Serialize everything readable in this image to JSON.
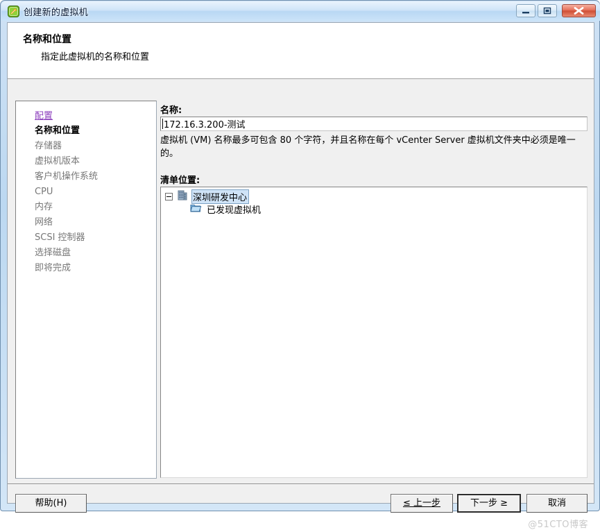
{
  "window": {
    "title": "创建新的虚拟机",
    "app_icon": "vm-new-icon",
    "controls": {
      "minimize": "minimize-icon",
      "maximize": "maximize-icon",
      "close": "close-icon"
    }
  },
  "header": {
    "title": "名称和位置",
    "subtitle": "指定此虚拟机的名称和位置"
  },
  "sidebar": {
    "items": [
      {
        "label": "配置",
        "state": "link"
      },
      {
        "label": "名称和位置",
        "state": "current"
      },
      {
        "label": "存储器",
        "state": "pending"
      },
      {
        "label": "虚拟机版本",
        "state": "pending"
      },
      {
        "label": "客户机操作系统",
        "state": "pending"
      },
      {
        "label": "CPU",
        "state": "pending"
      },
      {
        "label": "内存",
        "state": "pending"
      },
      {
        "label": "网络",
        "state": "pending"
      },
      {
        "label": "SCSI 控制器",
        "state": "pending"
      },
      {
        "label": "选择磁盘",
        "state": "pending"
      },
      {
        "label": "即将完成",
        "state": "pending"
      }
    ]
  },
  "main": {
    "name_label": "名称:",
    "name_value": "172.16.3.200-测试",
    "name_placeholder": "",
    "description": "虚拟机 (VM) 名称最多可包含 80 个字符，并且名称在每个 vCenter Server 虚拟机文件夹中必须是唯一的。",
    "location_label": "清单位置:",
    "tree": [
      {
        "label": "深圳研发中心",
        "icon": "datacenter-icon",
        "selected": true,
        "expanded": true
      },
      {
        "label": "已发现虚拟机",
        "icon": "folder-icon",
        "selected": false,
        "expanded": false
      }
    ]
  },
  "footer": {
    "help": "帮助(H)",
    "help_mnemonic": "H",
    "back": "≤ 上一步",
    "next": "下一步 ≥",
    "cancel": "取消"
  },
  "watermark": "@51CTO博客",
  "colors": {
    "accent_link": "#8c3fbd",
    "selection": "#cfe3f7",
    "close_button": "#cf4f36",
    "title_bar": "#bcd8f1"
  }
}
